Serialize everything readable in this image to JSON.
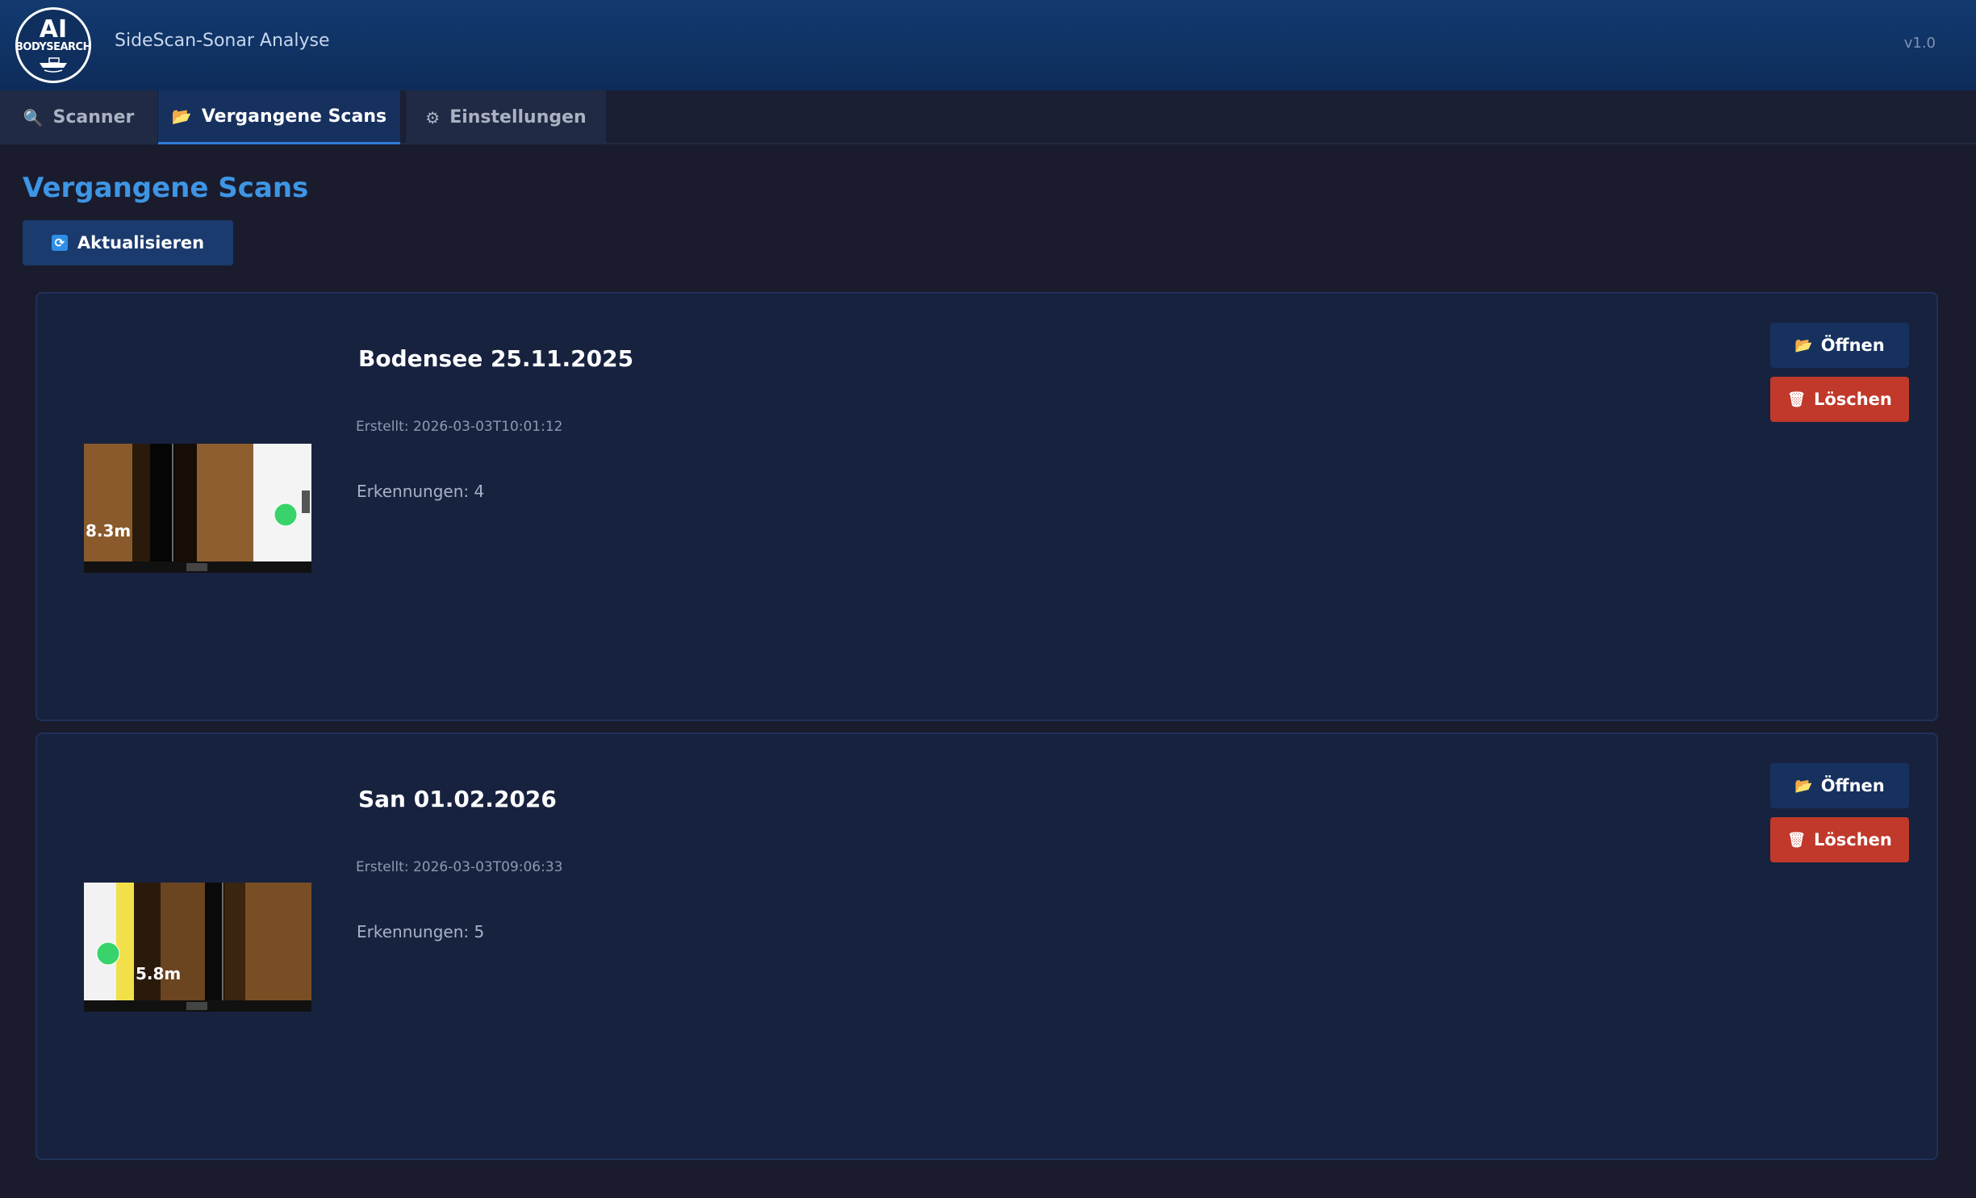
{
  "header": {
    "logo_line1": "AI",
    "logo_line2": "BODYSEARCH",
    "title": "SideScan-Sonar Analyse",
    "version": "v1.0"
  },
  "tabs": [
    {
      "label": "Scanner",
      "icon": "magnifier-icon",
      "active": false
    },
    {
      "label": "Vergangene Scans",
      "icon": "folder-icon",
      "active": true
    },
    {
      "label": "Einstellungen",
      "icon": "gear-icon",
      "active": false
    }
  ],
  "main": {
    "title": "Vergangene Scans",
    "refresh_label": "Aktualisieren"
  },
  "scans": [
    {
      "name": "Bodensee 25.11.2025",
      "created": "Erstellt: 2026-03-03T10:01:12",
      "detections": "Erkennungen: 4",
      "thumb_depth": "8.3m",
      "open_label": "Öffnen",
      "delete_label": "Löschen"
    },
    {
      "name": "San 01.02.2026",
      "created": "Erstellt: 2026-03-03T09:06:33",
      "detections": "Erkennungen: 5",
      "thumb_depth": "5.8m",
      "open_label": "Öffnen",
      "delete_label": "Löschen"
    }
  ],
  "colors": {
    "accent": "#3e95e4",
    "open_button": "#17315f",
    "delete_button": "#c0392b",
    "background": "#1a1c2e",
    "card": "#17223f"
  }
}
